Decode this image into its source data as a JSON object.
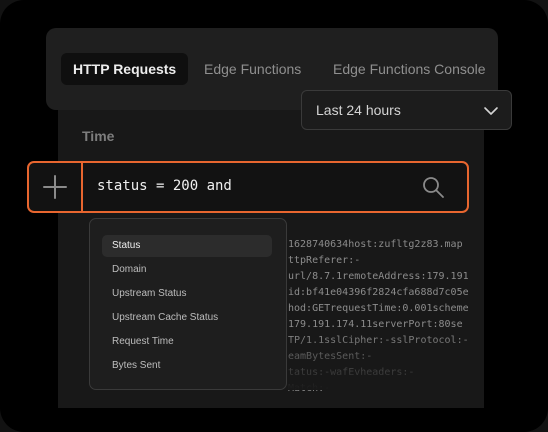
{
  "tabs": [
    {
      "label": "HTTP Requests",
      "active": true
    },
    {
      "label": "Edge Functions",
      "active": false
    },
    {
      "label": "Edge Functions Console",
      "active": false
    }
  ],
  "time_filter": {
    "selected": "Last 24 hours"
  },
  "table": {
    "header_time": "Time"
  },
  "search": {
    "query": "status = 200 and",
    "add_icon": "plus-icon",
    "search_icon": "search-icon"
  },
  "suggestions": {
    "selected_index": 0,
    "items": [
      "Status",
      "Domain",
      "Upstream Status",
      "Upstream Cache Status",
      "Request Time",
      "Bytes Sent"
    ]
  },
  "log_lines": [
    "1628740634host:zufltg2z83.map",
    "ttpReferer:-",
    "url/8.7.1remoteAddress:179.191",
    "id:bf41e04396f2824cfa688d7c05e",
    "hod:GETrequestTime:0.001scheme",
    "179.191.174.11serverPort:80se",
    "TP/1.1sslCipher:-sslProtocol:-",
    "eamBytesSent:-",
    "tatus:-wafEvheaders:-",
    "Match:-"
  ],
  "colors": {
    "accent": "#e8662f",
    "background": "#000000",
    "panel": "#1f1f1f"
  }
}
